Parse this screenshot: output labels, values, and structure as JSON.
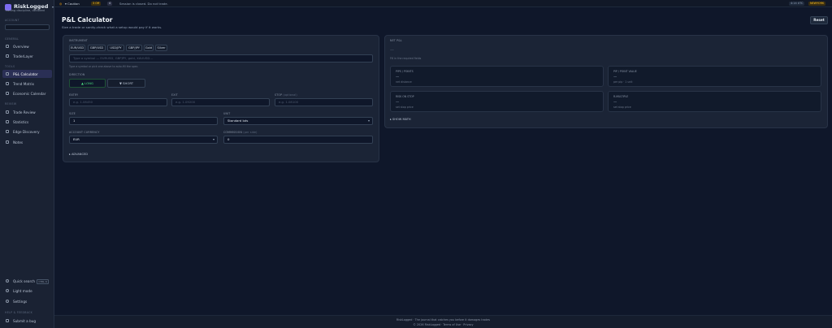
{
  "brand": {
    "name": "RiskLogged",
    "tagline": "Trading discipline, decoded"
  },
  "sidebar": {
    "account_label": "ACCOUNT",
    "section_general": "GENERAL",
    "section_tools": "TOOLS",
    "section_review": "REVIEW",
    "section_help": "HELP & FEEDBACK",
    "items": [
      {
        "label": "Overview"
      },
      {
        "label": "TraderLayer"
      },
      {
        "label": "P&L Calculator"
      },
      {
        "label": "Trend Matrix"
      },
      {
        "label": "Economic Calendar"
      },
      {
        "label": "Trade Review"
      },
      {
        "label": "Statistics"
      },
      {
        "label": "Edge Discovery"
      },
      {
        "label": "Notes"
      }
    ],
    "quick_search": "Quick search",
    "quick_search_kbd": "CTRL K",
    "light_mode": "Light mode",
    "settings": "Settings",
    "submit_bug": "Submit a bug"
  },
  "topbar": {
    "left_label": "Caution",
    "pill1": "3 Off",
    "pill2": "4",
    "status_text": "Session is closed. Do not trade.",
    "right1": "4:14 UTC",
    "right2": "NEWYORK"
  },
  "page": {
    "title": "P&L Calculator",
    "subtitle": "Size a trade or sanity-check what a setup would pay if it works.",
    "reset": "Reset"
  },
  "form": {
    "instrument_label": "INSTRUMENT",
    "chips": [
      "EUR/USD",
      "GBP/USD",
      "USD/JPY",
      "GBP/JPY",
      "Gold",
      "Silver"
    ],
    "symbol_placeholder": "Type a symbol — EURUSD, GBPJPY, gold, XAUUSD…",
    "symbol_hint": "Type a symbol or pick one above to auto-fill the spec.",
    "direction_label": "DIRECTION",
    "long": "▲ LONG",
    "short": "▼ SHORT",
    "entry_label": "ENTRY",
    "entry_ph": "e.g. 1.08450",
    "exit_label": "EXIT",
    "exit_ph": "e.g. 1.09200",
    "stop_label": "STOP",
    "stop_note": "(optional)",
    "stop_ph": "e.g. 1.08100",
    "size_label": "SIZE",
    "size_value": "1",
    "unit_label": "UNIT",
    "unit_value": "Standard lots",
    "currency_label": "ACCOUNT CURRENCY",
    "currency_value": "EUR",
    "commission_label": "COMMISSION",
    "commission_note": "(per side)",
    "commission_value": "0",
    "advanced": "▸ ADVANCED"
  },
  "results": {
    "net_label": "NET P&L",
    "net_value": "—",
    "net_hint": "Fill in the required fields",
    "cards": [
      {
        "label": "PIPS / POINTS",
        "value": "—",
        "sub": "net distance"
      },
      {
        "label": "PIP / POINT VALUE",
        "value": "—",
        "sub": "per pip · 1 unit"
      },
      {
        "label": "RISK ON STOP",
        "value": "—",
        "sub": "set stop price"
      },
      {
        "label": "R-MULTIPLE",
        "value": "—",
        "sub": "set stop price"
      }
    ],
    "show_math": "▸ SHOW MATH"
  },
  "footer": {
    "line1": "RiskLogged · The journal that catches you before it damages trades",
    "line2": "© 2026 RiskLogged  ·  Terms of Use  ·  Privacy"
  },
  "colors": {
    "accent": "#7c6cf2",
    "long_green": "#4ade80",
    "caution_amber": "#f59e0b"
  }
}
